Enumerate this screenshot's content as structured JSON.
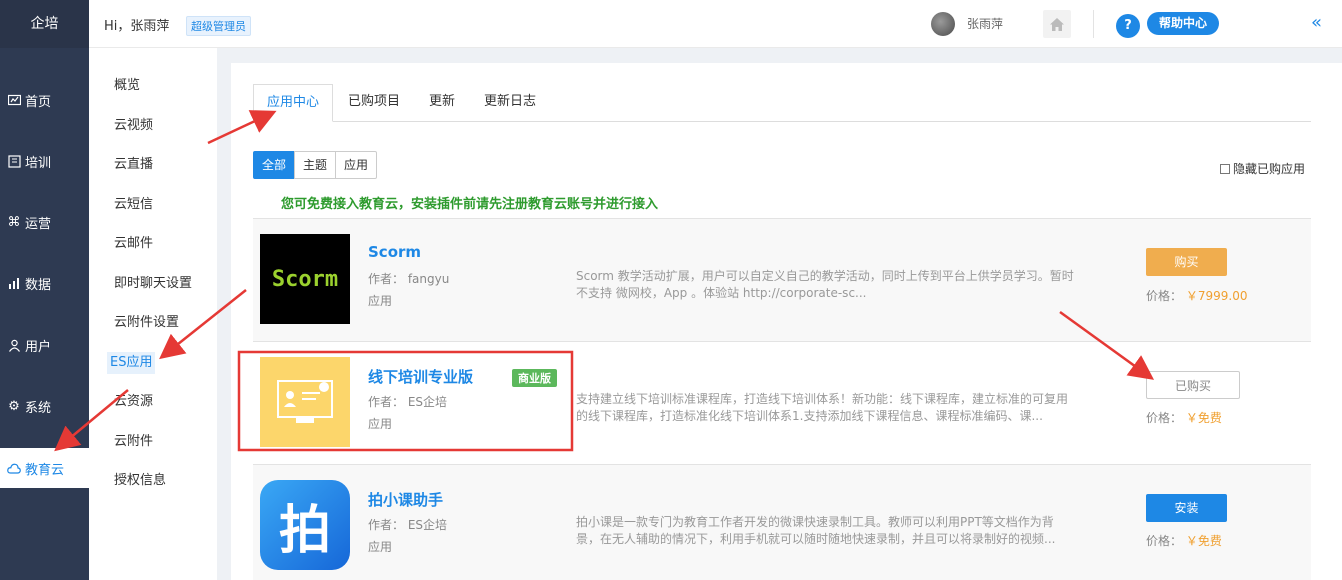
{
  "brand": "企培",
  "header": {
    "greeting": "Hi，张雨萍",
    "role": "超级管理员",
    "username": "张雨萍",
    "help_label": "帮助中心",
    "collapse_icon": "double-chevron-left-icon"
  },
  "nav": [
    {
      "label": "首页",
      "icon": "dashboard-icon"
    },
    {
      "label": "培训",
      "icon": "book-icon"
    },
    {
      "label": "运营",
      "icon": "command-icon"
    },
    {
      "label": "数据",
      "icon": "chart-icon"
    },
    {
      "label": "用户",
      "icon": "user-icon"
    },
    {
      "label": "系统",
      "icon": "gear-icon"
    },
    {
      "label": "教育云",
      "icon": "cloud-icon"
    }
  ],
  "subnav": [
    "概览",
    "云视频",
    "云直播",
    "云短信",
    "云邮件",
    "即时聊天设置",
    "云附件设置",
    "ES应用",
    "云资源",
    "云附件",
    "授权信息"
  ],
  "tabs": [
    "应用中心",
    "已购项目",
    "更新",
    "更新日志"
  ],
  "filters": [
    "全部",
    "主题",
    "应用"
  ],
  "hide_bought_label": "隐藏已购应用",
  "notice": "您可免费接入教育云，安装插件前请先注册教育云账号并进行接入",
  "apps": [
    {
      "name": "Scorm",
      "author": "作者： fangyu",
      "type": "应用",
      "thumb_text": "Scorm",
      "desc": "Scorm 教学活动扩展，用户可以自定义自己的教学活动，同时上传到平台上供学员学习。暂时不支持 微网校，App 。体验站 http://corporate-sc...",
      "button": "购买",
      "price_label": "价格：",
      "price": "￥7999.00"
    },
    {
      "name": "线下培训专业版",
      "badge": "商业版",
      "author": "作者： ES企培",
      "type": "应用",
      "desc": "支持建立线下培训标准课程库，打造线下培训体系！新功能：线下课程库，建立标准的可复用的线下课程库，打造标准化线下培训体系1.支持添加线下课程信息、课程标准编码、课...",
      "button": "已购买",
      "price_label": "价格：",
      "price": "￥免费"
    },
    {
      "name": "拍小课助手",
      "author": "作者： ES企培",
      "type": "应用",
      "thumb_text": "拍",
      "desc": "拍小课是一款专门为教育工作者开发的微课快速录制工具。教师可以利用PPT等文档作为背景，在无人辅助的情况下，利用手机就可以随时随地快速录制，并且可以将录制好的视频...",
      "button": "安装",
      "price_label": "价格：",
      "price": "￥免费"
    }
  ],
  "colors": {
    "sidebar": "#2e3a52",
    "accent": "#1e88e5",
    "buy": "#f0ad4e",
    "notice": "#2e9b2e",
    "annotation": "#e53935"
  }
}
